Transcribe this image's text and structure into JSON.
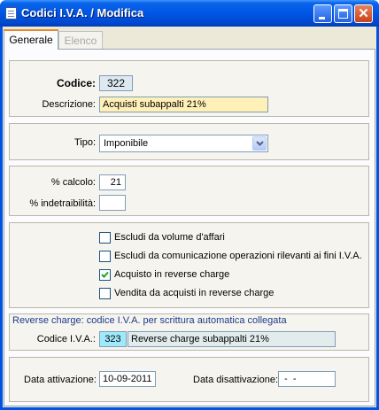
{
  "window": {
    "title": "Codici I.V.A. / Modifica",
    "controls": {
      "minimize": "minimize-icon",
      "maximize": "maximize-icon",
      "close": "close-icon"
    }
  },
  "tabs": [
    {
      "label": "Generale",
      "active": true
    },
    {
      "label": "Elenco",
      "active": false
    }
  ],
  "form": {
    "codice_label": "Codice:",
    "codice_value": "322",
    "descrizione_label": "Descrizione:",
    "descrizione_value": "Acquisti subappalti 21%",
    "tipo_label": "Tipo:",
    "tipo_value": "Imponibile",
    "calcolo_label": "% calcolo:",
    "calcolo_value": "21",
    "indetraibilita_label": "% indetraibilità:",
    "indetraibilita_value": "",
    "checkboxes": [
      {
        "label": "Escludi da volume d'affari",
        "checked": false
      },
      {
        "label": "Escludi da comunicazione operazioni rilevanti ai fini I.V.A.",
        "checked": false
      },
      {
        "label": "Acquisto in reverse charge",
        "checked": true
      },
      {
        "label": "Vendita da acquisti in reverse charge",
        "checked": false
      }
    ],
    "reverse_title": "Reverse charge: codice I.V.A. per scrittura automatica collegata",
    "codice_iva_label": "Codice I.V.A.:",
    "codice_iva_value": "323",
    "codice_iva_desc": "Reverse charge subappalti 21%",
    "data_attivazione_label": "Data attivazione:",
    "data_attivazione_value": "10-09-2011",
    "data_disattivazione_label": "Data disattivazione:",
    "data_disattivazione_value": " -  - "
  },
  "colors": {
    "titlebar": "#0054e3",
    "codice_field": "#dde8f0",
    "descrizione_field": "#fff0b8",
    "codice_iva_field": "#9eeafa",
    "reverse_title_text": "#1e3a8c"
  }
}
